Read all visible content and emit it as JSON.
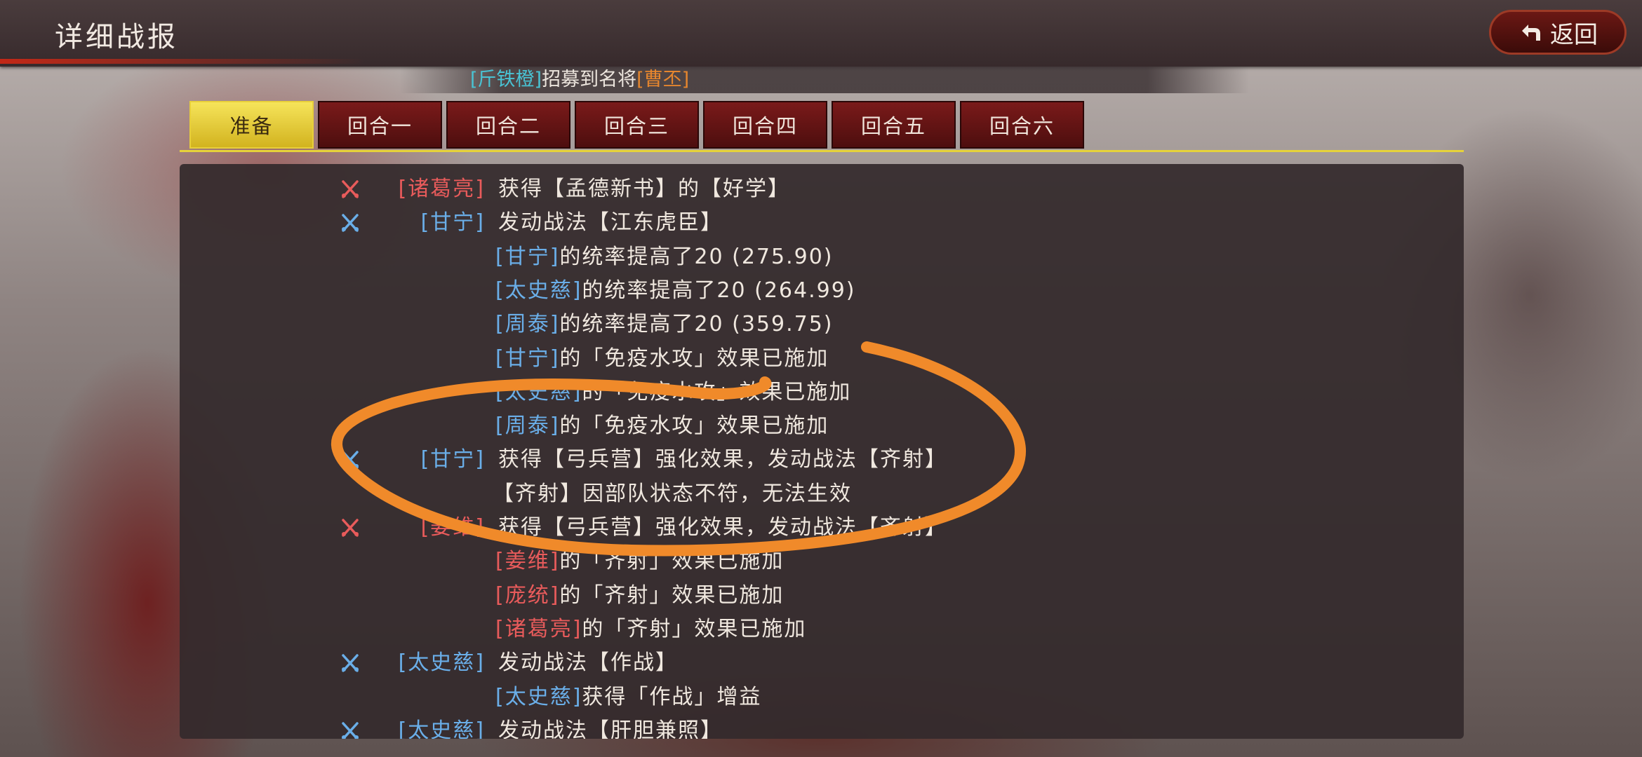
{
  "header": {
    "title": "详细战报",
    "back_label": "返回"
  },
  "marquee": {
    "player_name": "[斤铁橙]",
    "message": "招募到名将",
    "general": "[曹丕]"
  },
  "tabs": [
    {
      "label": "准备",
      "active": true
    },
    {
      "label": "回合一",
      "active": false
    },
    {
      "label": "回合二",
      "active": false
    },
    {
      "label": "回合三",
      "active": false
    },
    {
      "label": "回合四",
      "active": false
    },
    {
      "label": "回合五",
      "active": false
    },
    {
      "label": "回合六",
      "active": false
    }
  ],
  "log": {
    "lines": [
      {
        "side": "red",
        "name": "[诸葛亮]",
        "name_color": "red",
        "text": "获得【孟德新书】的【好学】"
      },
      {
        "side": "blue",
        "name": "[甘宁]",
        "name_color": "blue",
        "text": "发动战法【江东虎臣】"
      },
      {
        "side": "",
        "name": "[甘宁]",
        "name_color": "blue",
        "text": "的统率提高了20 (275.90)"
      },
      {
        "side": "",
        "name": "[太史慈]",
        "name_color": "blue",
        "text": "的统率提高了20 (264.99)"
      },
      {
        "side": "",
        "name": "[周泰]",
        "name_color": "blue",
        "text": "的统率提高了20 (359.75)"
      },
      {
        "side": "",
        "name": "[甘宁]",
        "name_color": "blue",
        "text": "的「免疫水攻」效果已施加"
      },
      {
        "side": "",
        "name": "[太史慈]",
        "name_color": "blue",
        "text": "的「免疫水攻」效果已施加"
      },
      {
        "side": "",
        "name": "[周泰]",
        "name_color": "blue",
        "text": "的「免疫水攻」效果已施加"
      },
      {
        "side": "blue",
        "name": "[甘宁]",
        "name_color": "blue",
        "text": "获得【弓兵营】强化效果，发动战法【齐射】"
      },
      {
        "side": "",
        "name": "",
        "name_color": "",
        "text": "【齐射】因部队状态不符，无法生效"
      },
      {
        "side": "red",
        "name": "[姜维]",
        "name_color": "red",
        "text": "获得【弓兵营】强化效果，发动战法【齐射】"
      },
      {
        "side": "",
        "name": "[姜维]",
        "name_color": "red",
        "text": "的「齐射」效果已施加"
      },
      {
        "side": "",
        "name": "[庞统]",
        "name_color": "red",
        "text": "的「齐射」效果已施加"
      },
      {
        "side": "",
        "name": "[诸葛亮]",
        "name_color": "red",
        "text": "的「齐射」效果已施加"
      },
      {
        "side": "blue",
        "name": "[太史慈]",
        "name_color": "blue",
        "text": "发动战法【作战】"
      },
      {
        "side": "",
        "name": "[太史慈]",
        "name_color": "blue",
        "text": "获得「作战」增益"
      },
      {
        "side": "blue",
        "name": "[太史慈]",
        "name_color": "blue",
        "text": "发动战法【肝胆兼照】"
      }
    ]
  },
  "colors": {
    "red_side": "#e85b5b",
    "blue_side": "#6aaee8",
    "annotation": "#f08a2a"
  }
}
